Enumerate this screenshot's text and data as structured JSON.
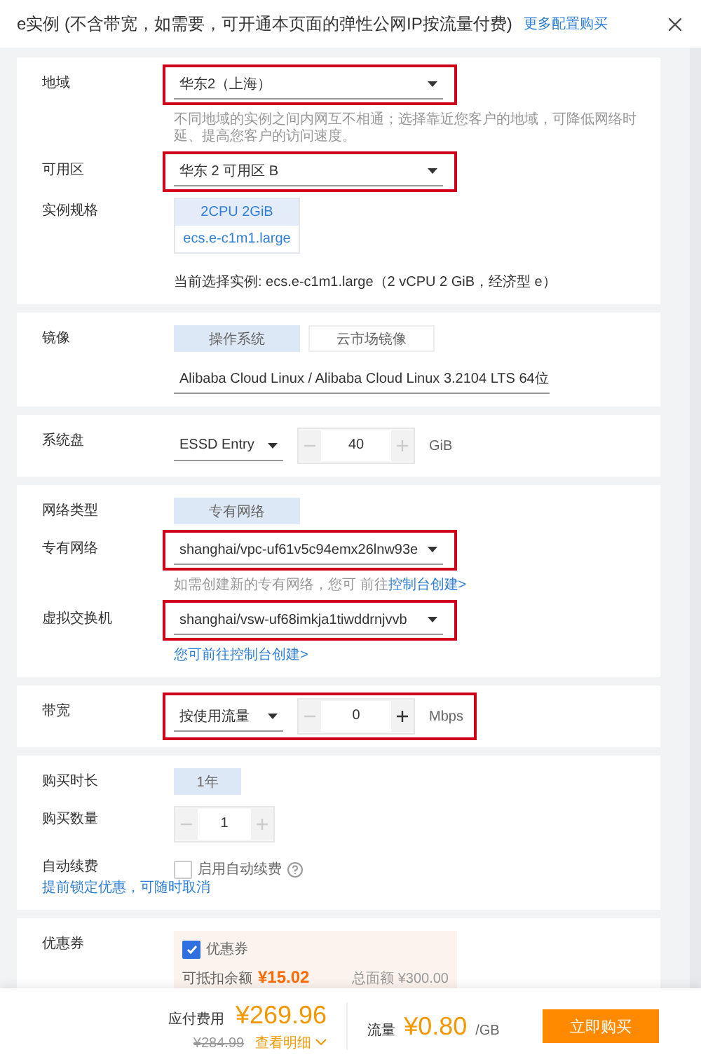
{
  "header": {
    "title": "e实例 (不含带宽，如需要，可开通本页面的弹性公网IP按流量付费)",
    "link": "更多配置购买"
  },
  "sections": [
    {
      "rows": [
        {
          "kind": "select",
          "label": "地域",
          "value": "华东2（上海）",
          "highlighted": true,
          "hint": "不同地域的实例之间内网互不相通；选择靠近您客户的地域，可降低网络时延、提高您客户的访问速度。"
        },
        {
          "kind": "select",
          "label": "可用区",
          "value": "华东 2 可用区 B",
          "highlighted": true
        },
        {
          "kind": "spec",
          "label": "实例规格",
          "spec_top": "2CPU 2GiB",
          "spec_bottom": "ecs.e-c1m1.large",
          "note": "当前选择实例: ecs.e-c1m1.large（2 vCPU 2 GiB，经济型 e）"
        }
      ]
    },
    {
      "rows": [
        {
          "kind": "segments",
          "label": "镜像",
          "options": [
            {
              "label": "操作系统",
              "selected": true
            },
            {
              "label": "云市场镜像",
              "selected": false
            }
          ],
          "value": "Alibaba Cloud Linux / Alibaba Cloud Linux 3.2104 LTS 64位"
        }
      ]
    },
    {
      "rows": [
        {
          "kind": "stepper",
          "label": "系统盘",
          "value": "ESSD Entry",
          "amount": "40",
          "unit": "GiB",
          "decrease_disabled": true,
          "increase_disabled": true,
          "highlighted": false
        }
      ]
    },
    {
      "rows": [
        {
          "kind": "segments",
          "label": "网络类型",
          "options": [
            {
              "label": "专有网络",
              "selected": true
            }
          ]
        },
        {
          "kind": "select",
          "label": "专有网络",
          "value": "shanghai/vpc-uf61v5c94emx26lnw93e",
          "highlighted": true,
          "hint": "如需创建新的专有网络，您可 前往",
          "hint_link": "控制台创建>"
        },
        {
          "kind": "select",
          "label": "虚拟交换机",
          "value": "shanghai/vsw-uf68imkja1tiwddrnjvvb",
          "highlighted": true,
          "hint_link": "您可前往控制台创建>"
        }
      ]
    },
    {
      "rows": [
        {
          "kind": "stepper",
          "label": "带宽",
          "value": "按使用流量",
          "amount": "0",
          "unit": "Mbps",
          "decrease_disabled": true,
          "increase_disabled": false,
          "highlighted": true
        }
      ]
    },
    {
      "rows": [
        {
          "kind": "segments",
          "label": "购买时长",
          "options": [
            {
              "label": "1年",
              "selected": true
            }
          ]
        },
        {
          "kind": "count",
          "label": "购买数量",
          "amount": "1",
          "decrease_disabled": true,
          "increase_disabled": true
        },
        {
          "kind": "checkbox",
          "label": "自动续费",
          "sublabel": "提前锁定优惠，可随时取消",
          "text": "启用自动续费",
          "checked": false
        }
      ]
    },
    {
      "rows": [
        {
          "kind": "coupon",
          "label": "优惠券",
          "text": "优惠券",
          "checked": true,
          "balance_label": "可抵扣余额",
          "balance": "¥15.02",
          "total": "总面额 ¥300.00"
        }
      ]
    }
  ],
  "footer": {
    "cost_label": "应付费用",
    "cost": "¥269.96",
    "original": "¥284.99",
    "details": "查看明细",
    "traffic_label": "流量",
    "traffic": "¥0.80",
    "traffic_unit": "/GB",
    "buy": "立即购买"
  }
}
